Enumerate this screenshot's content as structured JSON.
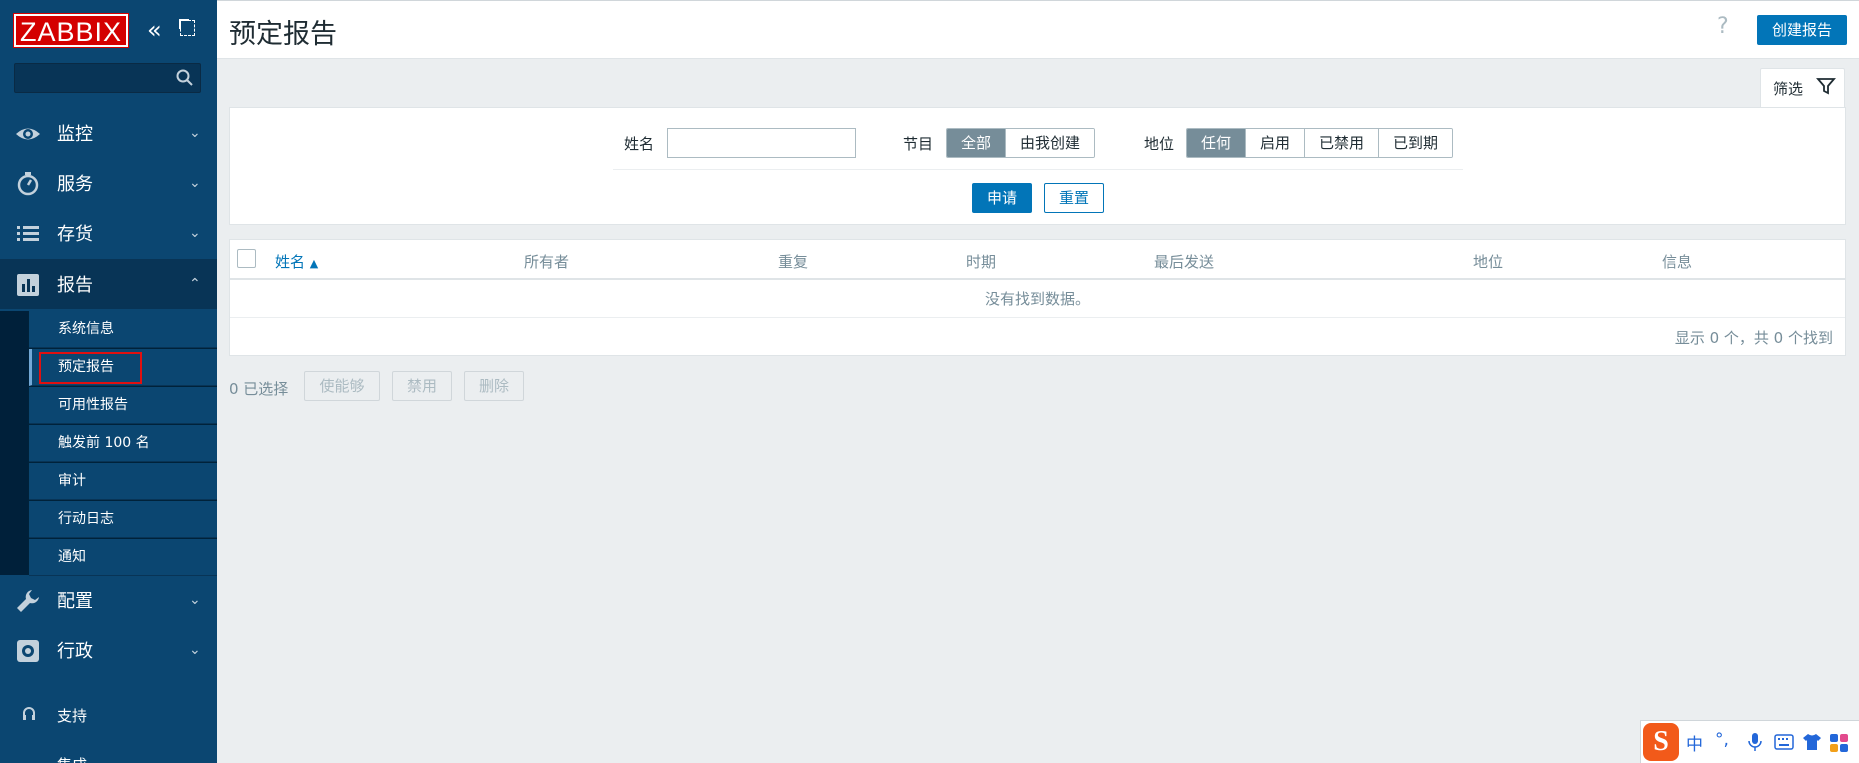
{
  "sidebar": {
    "logo": "ZABBIX",
    "search_placeholder": "",
    "menu": [
      {
        "label": "监控",
        "icon": "eye-icon",
        "chevron": "⌄"
      },
      {
        "label": "服务",
        "icon": "stopwatch-icon",
        "chevron": "⌄"
      },
      {
        "label": "存货",
        "icon": "list-icon",
        "chevron": "⌄"
      },
      {
        "label": "报告",
        "icon": "bar-chart-icon",
        "chevron": "⌃"
      },
      {
        "label": "配置",
        "icon": "wrench-icon",
        "chevron": "⌄"
      },
      {
        "label": "行政",
        "icon": "gear-icon",
        "chevron": "⌄"
      }
    ],
    "submenu": [
      "系统信息",
      "预定报告",
      "可用性报告",
      "触发前 100 名",
      "审计",
      "行动日志",
      "通知"
    ],
    "support": "支持",
    "integrations": "集成"
  },
  "header": {
    "title": "预定报告",
    "help": "?",
    "create_button": "创建报告"
  },
  "filter": {
    "tab_label": "筛选",
    "name_label": "姓名",
    "name_value": "",
    "show_label": "节目",
    "show_options": [
      "全部",
      "由我创建"
    ],
    "show_selected": "全部",
    "status_label": "地位",
    "status_options": [
      "任何",
      "启用",
      "已禁用",
      "已到期"
    ],
    "status_selected": "任何",
    "apply": "申请",
    "reset": "重置"
  },
  "table": {
    "columns": [
      "姓名",
      "所有者",
      "重复",
      "时期",
      "最后发送",
      "地位",
      "信息"
    ],
    "sort_indicator": "▲",
    "empty_text": "没有找到数据。",
    "paging_text": "显示 0 个，共 0 个找到"
  },
  "actions": {
    "selected": "0 已选择",
    "enable": "使能够",
    "disable": "禁用",
    "delete": "删除"
  },
  "ime": {
    "logo": "S",
    "mode": "中",
    "punct": "°,"
  },
  "colors": {
    "sidebar": "#0b4671",
    "accent": "#0275b8",
    "logo_red": "#d40000"
  }
}
